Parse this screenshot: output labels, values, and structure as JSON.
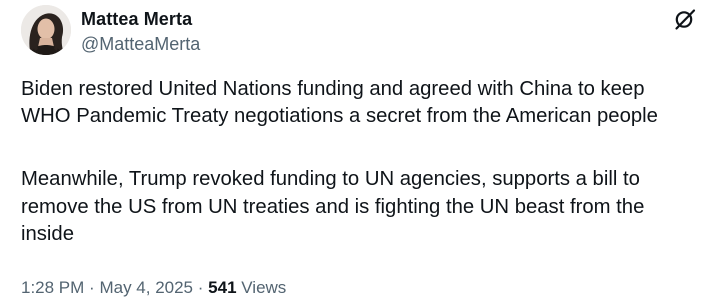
{
  "author": {
    "display_name": "Mattea Merta",
    "handle": "@MatteaMerta"
  },
  "icons": {
    "avatar": "profile-photo",
    "top_right": "grok-icon"
  },
  "tweet": {
    "lines": [
      "Biden restored United Nations funding and agreed with China to keep",
      "WHO Pandemic Treaty negotiations a secret from the American people",
      "Meanwhile, Trump revoked funding to UN agencies, supports a bill to",
      "remove the US from UN treaties and is fighting the UN beast from the",
      "inside"
    ]
  },
  "meta": {
    "time": "1:28 PM",
    "separator": "·",
    "date": "May 4, 2025",
    "views_count": "541",
    "views_label": "Views"
  },
  "colors": {
    "primary_text": "#0f1419",
    "secondary_text": "#536471"
  }
}
